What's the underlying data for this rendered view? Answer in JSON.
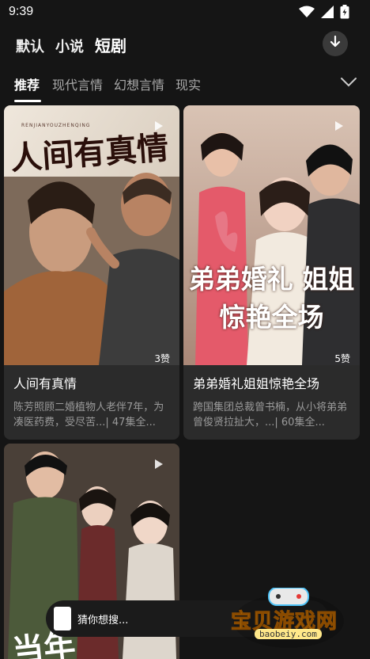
{
  "status": {
    "time": "9:39"
  },
  "top_tabs": [
    {
      "label": "默认"
    },
    {
      "label": "小说"
    },
    {
      "label": "短剧"
    }
  ],
  "categories": [
    {
      "label": "推荐"
    },
    {
      "label": "现代言情"
    },
    {
      "label": "幻想言情"
    },
    {
      "label": "现实"
    }
  ],
  "cards": [
    {
      "cover_text": "人间有真情",
      "cover_subtext": "RENJIANYOUZHENQING",
      "likes": "3赞",
      "title": "人间有真情",
      "desc": "陈芳照顾二婚植物人老伴7年，为凑医药费，受尽苦...| 47集全..."
    },
    {
      "cover_text": "弟弟婚礼 姐姐惊艳全场",
      "likes": "5赞",
      "title": "弟弟婚礼姐姐惊艳全场",
      "desc": "跨国集团总裁曾书楠，从小将弟弟曾俊贤拉扯大，...| 60集全..."
    },
    {
      "cover_text": "当年"
    }
  ],
  "search": {
    "placeholder": "猜你想搜..."
  },
  "watermark": {
    "brand": "宝贝游戏网",
    "url": "baobeiy.com"
  },
  "colors": {
    "background": "#151515",
    "card": "#2b2b2b",
    "watermark": "#ffd23a"
  }
}
